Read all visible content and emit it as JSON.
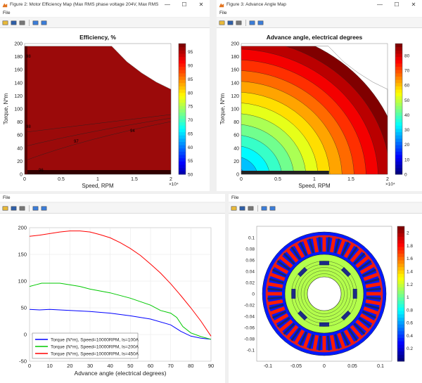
{
  "windows": [
    {
      "title": "Figure 2: Motor Efficiency Map (Max RMS phase voltage 204V, Max RMS ...",
      "menu": [
        "File"
      ],
      "chart_data": {
        "type": "heatmap",
        "title": "Efficiency, %",
        "xlabel": "Speed, RPM",
        "ylabel": "Torque, N*m",
        "x_multiplier": "×10⁴",
        "xlim": [
          0,
          2
        ],
        "ylim": [
          0,
          200
        ],
        "xticks": [
          "0",
          "0.5",
          "1",
          "1.5",
          "2"
        ],
        "yticks": [
          "0",
          "20",
          "40",
          "60",
          "80",
          "100",
          "120",
          "140",
          "160",
          "180",
          "200"
        ],
        "colorbar": {
          "range": [
            50,
            98
          ],
          "ticks": [
            "50",
            "55",
            "60",
            "65",
            "70",
            "75",
            "80",
            "85",
            "90",
            "95"
          ]
        },
        "region_boundary": [
          [
            0,
            196
          ],
          [
            0.7,
            196
          ],
          [
            1.19,
            196
          ],
          [
            1.4,
            172
          ],
          [
            1.6,
            155
          ],
          [
            1.8,
            141
          ],
          [
            2.0,
            130
          ],
          [
            2.0,
            0
          ],
          [
            0,
            0
          ]
        ],
        "contour_labels": [
          "98",
          "98",
          "96",
          "97",
          "94"
        ]
      }
    },
    {
      "title": "Figure 3: Advance Angle Map",
      "menu": [
        "File"
      ],
      "chart_data": {
        "type": "heatmap",
        "title": "Advance angle, electrical degrees",
        "xlabel": "Speed, RPM",
        "ylabel": "Torque, N*m",
        "x_multiplier": "×10⁴",
        "xlim": [
          0,
          2
        ],
        "ylim": [
          0,
          200
        ],
        "xticks": [
          "0",
          "0.5",
          "1",
          "1.5",
          "2"
        ],
        "yticks": [
          "0",
          "20",
          "40",
          "60",
          "80",
          "100",
          "120",
          "140",
          "160",
          "180",
          "200"
        ],
        "colorbar": {
          "range": [
            0,
            88
          ],
          "ticks": [
            "0",
            "10",
            "20",
            "30",
            "40",
            "50",
            "60",
            "70",
            "80"
          ]
        },
        "region_boundary": [
          [
            0,
            196
          ],
          [
            1.19,
            196
          ],
          [
            1.4,
            172
          ],
          [
            1.6,
            155
          ],
          [
            1.8,
            141
          ],
          [
            2.0,
            130
          ],
          [
            2.0,
            0
          ],
          [
            0,
            0
          ]
        ]
      }
    },
    {
      "title": "",
      "menu": [
        "File"
      ],
      "chart_data": {
        "type": "line",
        "xlabel": "Advance angle (electrical degrees)",
        "ylabel": "",
        "xlim": [
          0,
          90
        ],
        "ylim": [
          -50,
          200
        ],
        "xticks": [
          "0",
          "10",
          "20",
          "30",
          "40",
          "50",
          "60",
          "70",
          "80",
          "90"
        ],
        "yticks": [
          "-50",
          "0",
          "50",
          "100",
          "150",
          "200"
        ],
        "legend_position": "bottom-left",
        "series": [
          {
            "name": "Torque (N*m), Speed=10000RPM, Is=100A",
            "color": "#0000ff",
            "x": [
              0,
              5,
              10,
              20,
              30,
              40,
              50,
              60,
              70,
              75,
              80,
              85,
              90
            ],
            "y": [
              47,
              46,
              47,
              45,
              43,
              40,
              35,
              29,
              18,
              6,
              -3,
              -7,
              -9
            ]
          },
          {
            "name": "Torque (N*m), Speed=10000RPM, Is=200A",
            "color": "#00c800",
            "x": [
              0,
              3,
              6,
              10,
              15,
              20,
              25,
              30,
              40,
              50,
              60,
              65,
              70,
              73,
              76,
              80,
              85,
              90
            ],
            "y": [
              90,
              93,
              96,
              96,
              96,
              93,
              90,
              85,
              78,
              68,
              55,
              45,
              40,
              32,
              15,
              3,
              -4,
              -9
            ]
          },
          {
            "name": "Torque (N*m), Speed=10000RPM, Is=450A",
            "color": "#ff0000",
            "x": [
              0,
              5,
              10,
              15,
              20,
              25,
              30,
              35,
              40,
              45,
              50,
              55,
              60,
              65,
              70,
              75,
              80,
              85,
              90
            ],
            "y": [
              184,
              186,
              189,
              192,
              194,
              194,
              192,
              187,
              181,
              172,
              161,
              148,
              132,
              115,
              95,
              73,
              50,
              25,
              -3
            ]
          }
        ]
      }
    },
    {
      "title": "",
      "menu": [
        "File"
      ],
      "chart_data": {
        "type": "heatmap",
        "xlim": [
          -0.12,
          0.12
        ],
        "ylim": [
          -0.12,
          0.12
        ],
        "xticks": [
          "-0.1",
          "-0.05",
          "0",
          "0.05",
          "0.1"
        ],
        "yticks": [
          "-0.1",
          "-0.08",
          "-0.06",
          "-0.04",
          "-0.02",
          "0",
          "0.02",
          "0.04",
          "0.06",
          "0.08",
          "0.1"
        ],
        "colorbar": {
          "range": [
            0,
            2.1
          ],
          "ticks": [
            "0.2",
            "0.4",
            "0.6",
            "0.8",
            "1",
            "1.2",
            "1.4",
            "1.6",
            "1.8",
            "2"
          ]
        },
        "geometry": {
          "stator_outer_radius": 0.11,
          "rotor_outer_radius": 0.07,
          "shaft_radius": 0.03,
          "stator_slots": 36,
          "rotor_magnet_poles": 8
        }
      }
    }
  ]
}
